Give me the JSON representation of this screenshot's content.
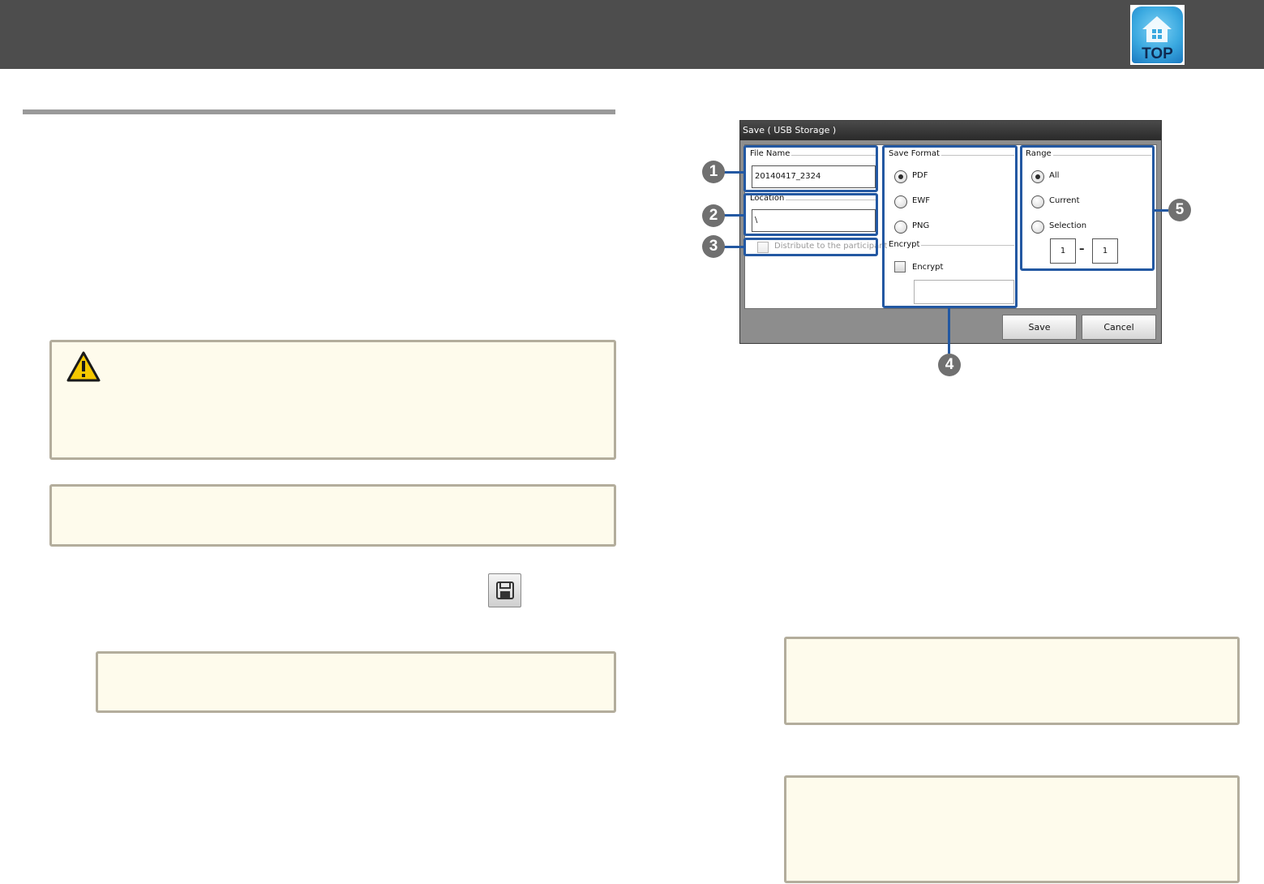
{
  "header": {
    "top_button": {
      "label": "TOP",
      "icon": "house-icon"
    }
  },
  "toolbar_icon": {
    "icon": "floppy-disk-icon"
  },
  "warning": {
    "icon": "warning-triangle-icon",
    "color": "#f5c800"
  },
  "dialog": {
    "title": "Save ( USB Storage )",
    "file_name": {
      "legend": "File Name",
      "value": "20140417_2324"
    },
    "location": {
      "legend": "Location",
      "value": "\\"
    },
    "distribute": {
      "label": "Distribute to the participants.",
      "checked": false,
      "enabled": false
    },
    "save_format": {
      "legend": "Save Format",
      "options": [
        {
          "label": "PDF",
          "selected": true
        },
        {
          "label": "EWF",
          "selected": false
        },
        {
          "label": "PNG",
          "selected": false
        }
      ]
    },
    "encrypt": {
      "legend": "Encrypt",
      "checkbox_label": "Encrypt",
      "checked": false,
      "password": ""
    },
    "range": {
      "legend": "Range",
      "options": [
        {
          "label": "All",
          "selected": true
        },
        {
          "label": "Current",
          "selected": false
        },
        {
          "label": "Selection",
          "selected": false
        }
      ],
      "from": "1",
      "separator": "–",
      "to": "1"
    },
    "buttons": {
      "save": "Save",
      "cancel": "Cancel"
    }
  },
  "callouts": [
    "1",
    "2",
    "3",
    "4",
    "5"
  ],
  "highlight_color": "#2358a2"
}
